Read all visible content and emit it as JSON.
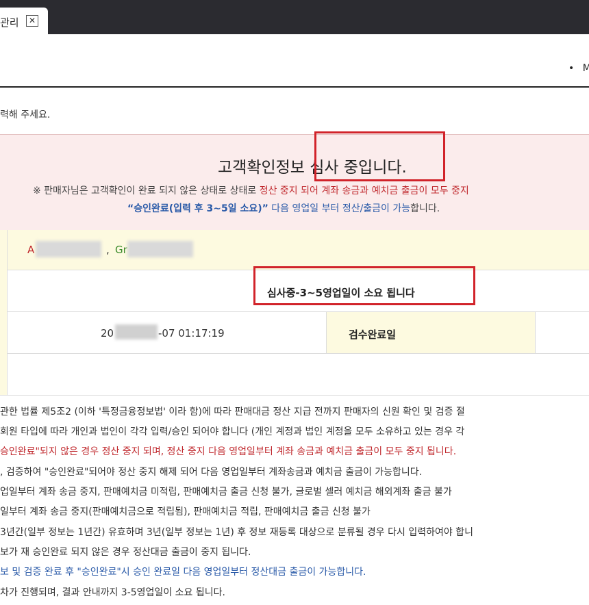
{
  "tab": {
    "label": "관리",
    "close": "✕"
  },
  "header": {
    "bullet": "•",
    "right_text": "M"
  },
  "intro": "력해 주세요.",
  "alert": {
    "title": "고객확인정보 심사 중입니다.",
    "line1_a": "※ 판매자님은 고객확인이 완료 되지 않은 상태로 상태로 ",
    "line1_b": "정산 중지 되어 계좌 송금과 예치금 출금이 모두 중지",
    "line2_a": "“승인완료(입력 후 3~5일 소요)”",
    "line2_b": " 다음 영업일 부터 ",
    "line2_c": "정산/출금이 가능",
    "line2_d": "합니다."
  },
  "table": {
    "name_prefix_a": "A",
    "comma": ",",
    "name_prefix_g": "Gr",
    "review_status": "심사중-3~5영업일이 소요 됩니다",
    "date_prefix": "20",
    "date_suffix": "-07 01:17:19",
    "inspect_label": "검수완료일"
  },
  "notes": [
    {
      "text": "관한 법률 제5조2 (이하 '특정금융정보법' 이라 함)에 따라 판매대금 정산 지급 전까지 판매자의 신원 확인 및 검증 절",
      "color": "#333333"
    },
    {
      "text": "회원 타입에 따라 개인과 법인이 각각 입력/승인 되어야 합니다 (개인 계정과 법인 계정을 모두 소유하고 있는 경우 각",
      "color": "#333333"
    },
    {
      "text": "승인완료\"되지 않은 경우 정산 중지 되며, 정산 중지 다음 영업일부터 계좌 송금과 예치금 출금이 모두 중지 됩니다.",
      "color": "#c0282d"
    },
    {
      "text": ", 검증하여 \"승인완료\"되어야 정산 중지 해제 되어 다음 영업일부터 계좌송금과 예치금 출금이 가능합니다.",
      "color": "#333333"
    },
    {
      "text": "업일부터 계좌 송금 중지, 판매예치금 미적립, 판매예치금 출금 신청 불가, 글로벌 셀러 예치금 해외계좌 출금 불가",
      "color": "#333333"
    },
    {
      "text": "일부터 계좌 송금 중지(판매예치금으로 적립됨), 판매예치금 적립, 판매예치금 출금 신청 불가",
      "color": "#333333"
    },
    {
      "text": "3년간(일부 정보는 1년간) 유효하며 3년(일부 정보는 1년) 후 정보 재등록 대상으로 분류될 경우 다시 입력하여야 합니",
      "color": "#333333"
    },
    {
      "text": "보가 재 승인완료 되지 않은 경우 정산대금 출금이 중지 됩니다.",
      "color": "#333333"
    },
    {
      "text": "보 및 검증 완료 후 \"승인완료\"시 승인 완료일 다음 영업일부터 정산대금 출금이 가능합니다.",
      "color": "#2a5aa8"
    },
    {
      "text": "차가 진행되며, 결과 안내까지 3-5영업일이 소요 됩니다.",
      "color": "#333333"
    }
  ]
}
